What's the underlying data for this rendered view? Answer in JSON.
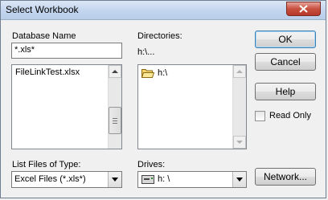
{
  "window": {
    "title": "Select Workbook"
  },
  "database": {
    "label": "Database Name",
    "value": "*.xls*",
    "files": [
      "FileLinkTest.xlsx"
    ]
  },
  "directories": {
    "label": "Directories:",
    "path": "h:\\...",
    "items": [
      "h:\\"
    ]
  },
  "filetype": {
    "label": "List Files of Type:",
    "value": "Excel Files (*.xls*)"
  },
  "drives": {
    "label": "Drives:",
    "value": "h: \\"
  },
  "buttons": {
    "ok": "OK",
    "cancel": "Cancel",
    "help": "Help",
    "network": "Network..."
  },
  "read_only": {
    "label": "Read Only",
    "checked": false
  },
  "icons": {
    "close": "close-icon",
    "folder": "folder-open-icon",
    "drive": "drive-icon"
  },
  "colors": {
    "title_bar": "#c4d6ee",
    "close_button": "#c7503f",
    "dialog_bg": "#f0f0f0"
  }
}
